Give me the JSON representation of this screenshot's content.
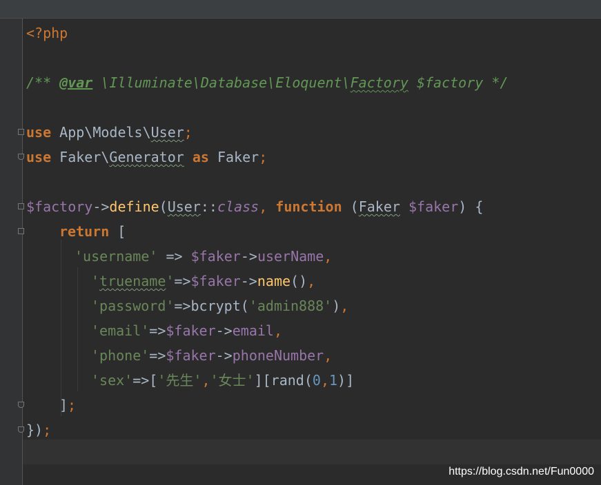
{
  "code": {
    "l1": "<?php",
    "l2": {
      "open": "/** ",
      "tag": "@var",
      "mid": " \\Illuminate\\Database\\Eloquent\\",
      "cls": "Factory",
      "end": " $factory */"
    },
    "l3": {
      "kw": "use",
      "a": " App\\Models\\",
      "b": "User",
      "c": ";"
    },
    "l4": {
      "kw": "use",
      "a": " Faker\\",
      "b": "Generator",
      "as": " as ",
      "c": "Faker",
      "d": ";"
    },
    "l5": {
      "var": "$factory",
      "arrow": "->",
      "fn": "define",
      "p1": "(",
      "user": "User",
      "dc": "::",
      "cls": "class",
      "comma": ", ",
      "function": "function",
      "sp": " (",
      "faker": "Faker",
      "sp2": " ",
      "fv": "$faker",
      "close": ") {"
    },
    "l6": {
      "ret": "return",
      "br": " ["
    },
    "l7": {
      "key": "'username'",
      "arr": " => ",
      "fv": "$faker",
      "ar": "->",
      "prop": "userName",
      "c": ","
    },
    "l8": {
      "q1": "'",
      "key": "truename",
      "q2": "'",
      "arr": "=>",
      "fv": "$faker",
      "ar": "->",
      "fn": "name",
      "p": "()",
      "c": ","
    },
    "l9": {
      "key": "'password'",
      "arr": "=>",
      "fn": "bcrypt",
      "p1": "(",
      "str": "'admin888'",
      "p2": ")",
      "c": ","
    },
    "l10": {
      "key": "'email'",
      "arr": "=>",
      "fv": "$faker",
      "ar": "->",
      "prop": "email",
      "c": ","
    },
    "l11": {
      "key": "'phone'",
      "arr": "=>",
      "fv": "$faker",
      "ar": "->",
      "prop": "phoneNumber",
      "c": ","
    },
    "l12": {
      "key": "'sex'",
      "arr": "=>[",
      "s1": "'先生'",
      "cm": ",",
      "s2": "'女士'",
      "b": "][",
      "fn": "rand",
      "p1": "(",
      "n0": "0",
      "cm2": ",",
      "n1": "1",
      "p2": ")]"
    },
    "l13": {
      "b": "]",
      "c": ";"
    },
    "l14": {
      "b": "})",
      "c": ";"
    }
  },
  "watermark": "https://blog.csdn.net/Fun0000"
}
